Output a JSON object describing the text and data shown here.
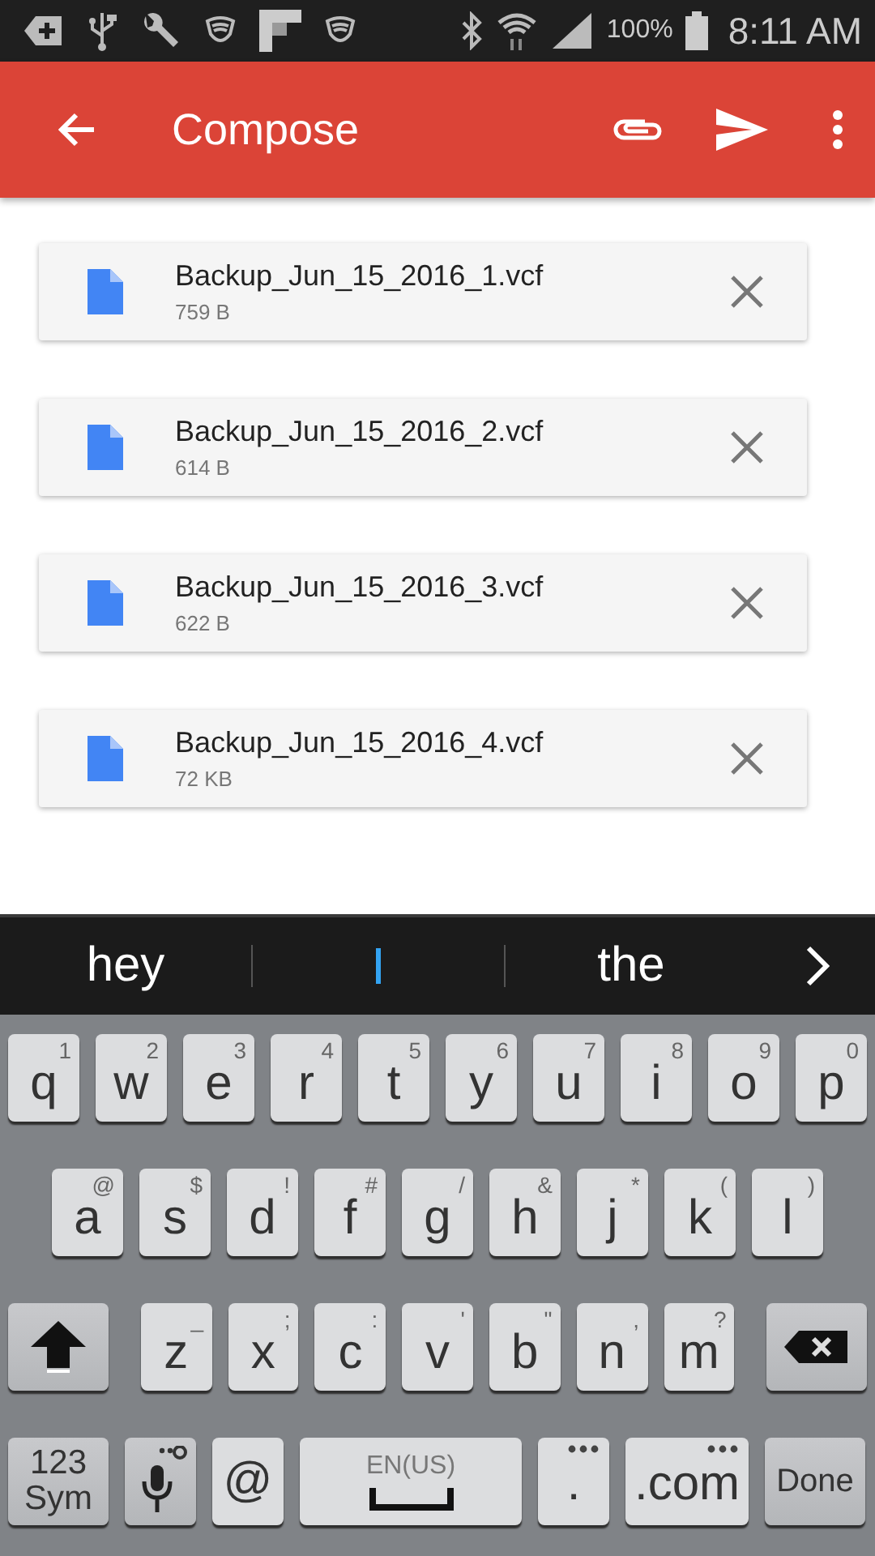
{
  "status_bar": {
    "battery": "100%",
    "time": "8:11 AM"
  },
  "app_bar": {
    "title": "Compose"
  },
  "attachments": [
    {
      "name": "Backup_Jun_15_2016_1.vcf",
      "size": "759 B"
    },
    {
      "name": "Backup_Jun_15_2016_2.vcf",
      "size": "614 B"
    },
    {
      "name": "Backup_Jun_15_2016_3.vcf",
      "size": "622 B"
    },
    {
      "name": "Backup_Jun_15_2016_4.vcf",
      "size": "72 KB"
    }
  ],
  "suggestions": [
    {
      "kind": "word",
      "text": "hey"
    },
    {
      "kind": "cursor"
    },
    {
      "kind": "word",
      "text": "the"
    }
  ],
  "keyboard": {
    "rows": [
      {
        "keys": [
          {
            "kind": "letter",
            "label": "q",
            "hint": "1"
          },
          {
            "kind": "letter",
            "label": "w",
            "hint": "2"
          },
          {
            "kind": "letter",
            "label": "e",
            "hint": "3"
          },
          {
            "kind": "letter",
            "label": "r",
            "hint": "4"
          },
          {
            "kind": "letter",
            "label": "t",
            "hint": "5"
          },
          {
            "kind": "letter",
            "label": "y",
            "hint": "6"
          },
          {
            "kind": "letter",
            "label": "u",
            "hint": "7"
          },
          {
            "kind": "letter",
            "label": "i",
            "hint": "8"
          },
          {
            "kind": "letter",
            "label": "o",
            "hint": "9"
          },
          {
            "kind": "letter",
            "label": "p",
            "hint": "0"
          }
        ]
      },
      {
        "keys": [
          {
            "kind": "letter",
            "label": "a",
            "hint": "@"
          },
          {
            "kind": "letter",
            "label": "s",
            "hint": "$"
          },
          {
            "kind": "letter",
            "label": "d",
            "hint": "!"
          },
          {
            "kind": "letter",
            "label": "f",
            "hint": "#"
          },
          {
            "kind": "letter",
            "label": "g",
            "hint": "/"
          },
          {
            "kind": "letter",
            "label": "h",
            "hint": "&"
          },
          {
            "kind": "letter",
            "label": "j",
            "hint": "*"
          },
          {
            "kind": "letter",
            "label": "k",
            "hint": "("
          },
          {
            "kind": "letter",
            "label": "l",
            "hint": ")"
          }
        ]
      },
      {
        "keys": [
          {
            "kind": "shift"
          },
          {
            "kind": "letter",
            "label": "z",
            "hint": "_"
          },
          {
            "kind": "letter",
            "label": "x",
            "hint": ";"
          },
          {
            "kind": "letter",
            "label": "c",
            "hint": ":"
          },
          {
            "kind": "letter",
            "label": "v",
            "hint": "'"
          },
          {
            "kind": "letter",
            "label": "b",
            "hint": "\""
          },
          {
            "kind": "letter",
            "label": "n",
            "hint": ","
          },
          {
            "kind": "letter",
            "label": "m",
            "hint": "?"
          },
          {
            "kind": "backspace"
          }
        ]
      },
      {
        "keys": [
          {
            "kind": "sym",
            "lines": [
              "123",
              "Sym"
            ]
          },
          {
            "kind": "mic"
          },
          {
            "kind": "text",
            "label": "@"
          },
          {
            "kind": "space",
            "label": "EN(US)"
          },
          {
            "kind": "more",
            "label": "."
          },
          {
            "kind": "more",
            "label": ".com"
          },
          {
            "kind": "done",
            "label": "Done"
          }
        ]
      }
    ]
  }
}
